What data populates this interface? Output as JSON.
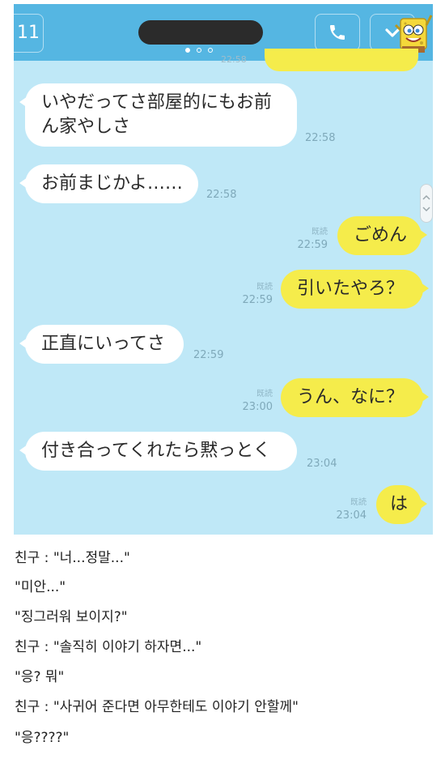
{
  "header": {
    "back_count": "11"
  },
  "chat": {
    "clipped_time": "22:58",
    "messages": [
      {
        "side": "in",
        "text": "いやだってさ部屋的にもお前ん家やしさ",
        "time": "22:58"
      },
      {
        "side": "in",
        "text": "お前まじかよ……",
        "time": "22:58"
      },
      {
        "side": "out",
        "text": "ごめん",
        "read": "既読",
        "time": "22:59"
      },
      {
        "side": "out",
        "text": "引いたやろ？",
        "read": "既読",
        "time": "22:59"
      },
      {
        "side": "in",
        "text": "正直にいってさ",
        "time": "22:59"
      },
      {
        "side": "out",
        "text": "うん、なに？",
        "read": "既読",
        "time": "23:00"
      },
      {
        "side": "in",
        "text": "付き合ってくれたら黙っとく",
        "time": "23:04"
      },
      {
        "side": "out",
        "text": "は",
        "read": "既読",
        "time": "23:04"
      }
    ]
  },
  "translation": [
    "친구 : \"너...정말...\"",
    "\"미안...\"",
    "\"징그러워 보이지?\"",
    "친구 : \"솔직히 이야기 하자면...\"",
    "\"응? 뭐\"",
    "친구 : \"사귀어 준다면 아무한테도 이야기 안할께\"",
    "\"응????\""
  ],
  "colors": {
    "header": "#55b6e2",
    "chat_bg": "#bfe8f7",
    "outgoing_bubble": "#f5ec4b",
    "incoming_bubble": "#ffffff"
  }
}
